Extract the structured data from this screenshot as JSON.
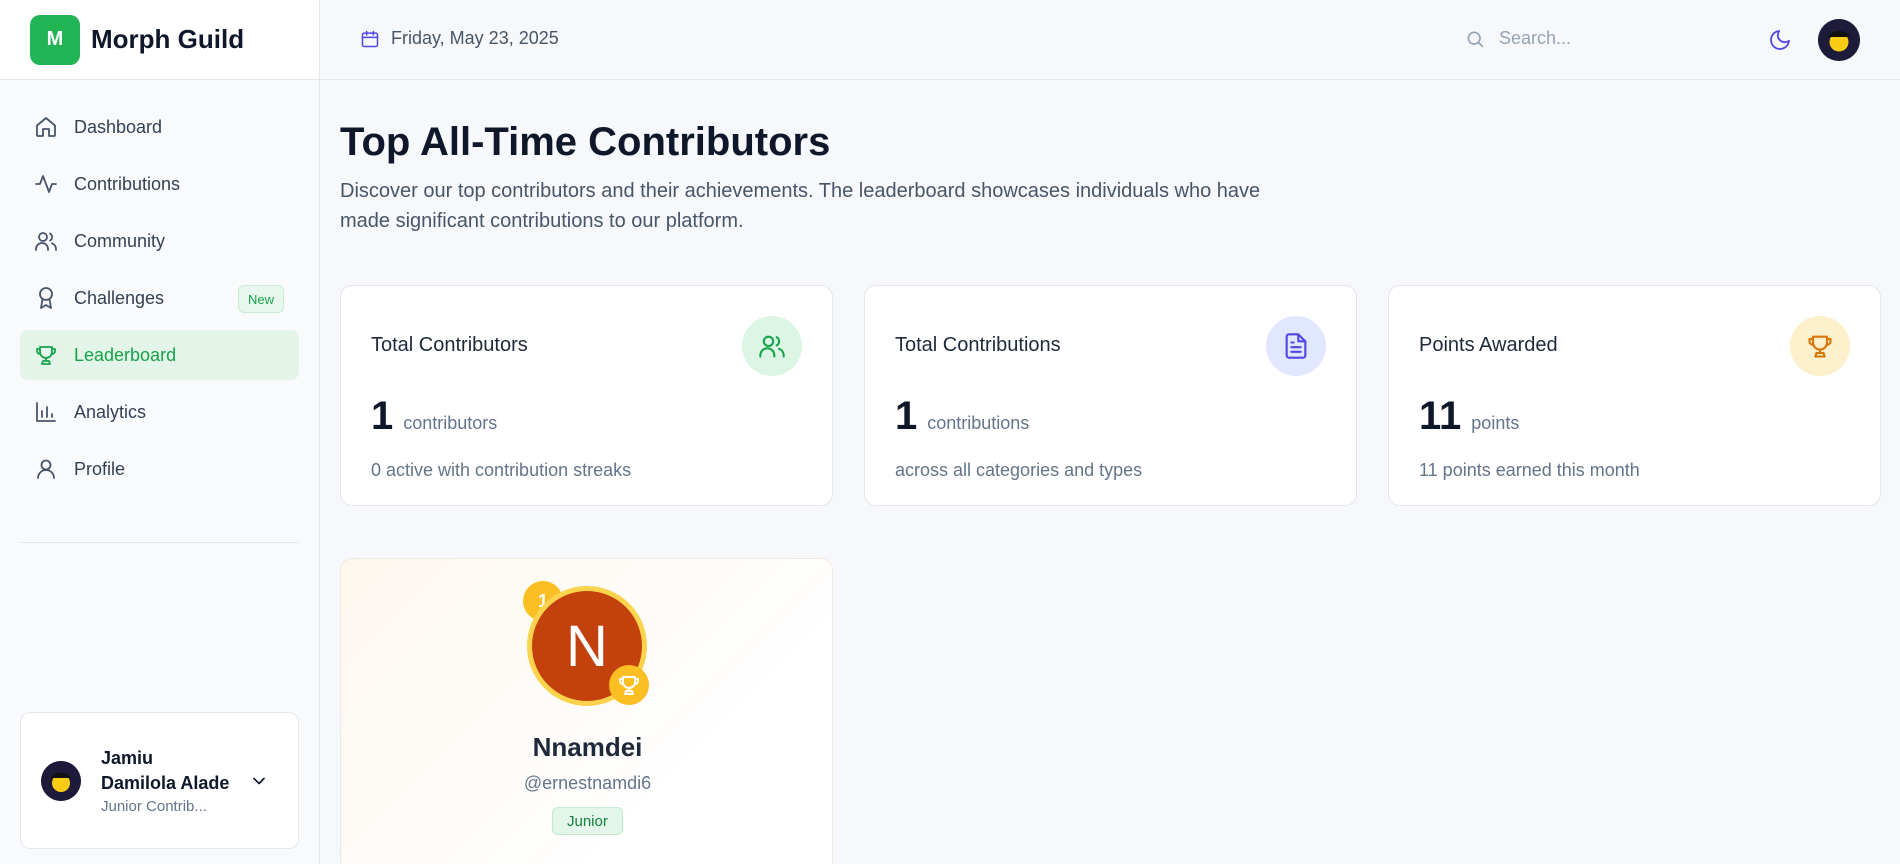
{
  "brand": {
    "logo_letter": "M",
    "name": "Morph Guild",
    "accent": "#22b455"
  },
  "header": {
    "date": "Friday, May 23, 2025",
    "search_placeholder": "Search...",
    "icons": [
      "calendar-icon",
      "search-icon",
      "moon-icon",
      "user-avatar"
    ]
  },
  "sidebar": {
    "items": [
      {
        "label": "Dashboard",
        "icon": "home-icon"
      },
      {
        "label": "Contributions",
        "icon": "activity-icon"
      },
      {
        "label": "Community",
        "icon": "users-icon"
      },
      {
        "label": "Challenges",
        "icon": "award-icon",
        "badge": "New"
      },
      {
        "label": "Leaderboard",
        "icon": "trophy-icon",
        "active": true
      },
      {
        "label": "Analytics",
        "icon": "bar-chart-icon"
      },
      {
        "label": "Profile",
        "icon": "user-icon"
      }
    ],
    "user": {
      "name": "Jamiu Damilola Alade",
      "role": "Junior Contrib..."
    }
  },
  "main": {
    "title": "Top All-Time Contributors",
    "description": "Discover our top contributors and their achievements. The leaderboard showcases individuals who have made significant contributions to our platform.",
    "stats": [
      {
        "title": "Total Contributors",
        "value": "1",
        "unit": "contributors",
        "sub": "0 active with contribution streaks",
        "icon": "users-icon",
        "color": "#16a34a"
      },
      {
        "title": "Total Contributions",
        "value": "1",
        "unit": "contributions",
        "sub": "across all categories and types",
        "icon": "file-text-icon",
        "color": "#4f46e5"
      },
      {
        "title": "Points Awarded",
        "value": "11",
        "unit": "points",
        "sub": "11 points earned this month",
        "icon": "trophy-icon",
        "color": "#d97706"
      }
    ],
    "leader": {
      "rank": "1",
      "initial": "N",
      "name": "Nnamdei",
      "handle": "@ernestnamdi6",
      "level": "Junior"
    }
  }
}
